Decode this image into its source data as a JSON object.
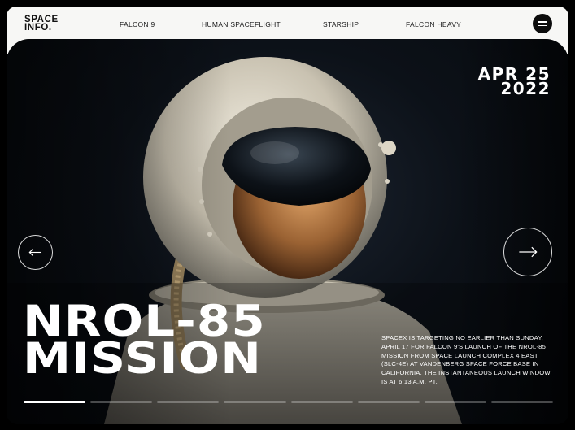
{
  "logo": {
    "line1": "SPACE",
    "line2": "INFO."
  },
  "nav": [
    {
      "label": "FALCON 9"
    },
    {
      "label": "HUMAN SPACEFLIGHT"
    },
    {
      "label": "STARSHIP"
    },
    {
      "label": "FALCON HEAVY"
    }
  ],
  "menu_icon": "hamburger-icon",
  "date": {
    "month_day": "APR 25",
    "year": "2022"
  },
  "arrows": {
    "prev_icon": "arrow-left-icon",
    "next_icon": "arrow-right-icon"
  },
  "hero": {
    "title_line1": "NROL-85",
    "title_line2": "MISSION",
    "description": "SpaceX is targeting no earlier than Sunday, April 17 for Falcon 9's launch of the NROL-85 mission from Space Launch Complex 4 East (SLC-4E) at Vandenberg Space Force Base in California. The instantaneous launch window is at 6:13 a.m. PT.",
    "image": "astronaut-helmet-photo"
  },
  "progress": {
    "total": 8,
    "active_index": 0
  },
  "colors": {
    "nav_bg": "#f7f7f5",
    "hero_bg": "#0c1118",
    "text_light": "#ffffff",
    "text_dark": "#111111"
  }
}
